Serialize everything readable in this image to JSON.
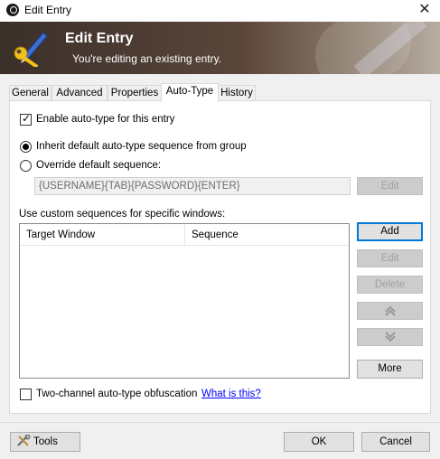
{
  "window": {
    "title": "Edit Entry",
    "close_glyph": "✕"
  },
  "banner": {
    "heading": "Edit Entry",
    "subheading": "You're editing an existing entry."
  },
  "tabs": [
    {
      "label": "General"
    },
    {
      "label": "Advanced"
    },
    {
      "label": "Properties"
    },
    {
      "label": "Auto-Type"
    },
    {
      "label": "History"
    }
  ],
  "active_tab": "Auto-Type",
  "autotype": {
    "enable_label": "Enable auto-type for this entry",
    "enable_checked": true,
    "inherit_label": "Inherit default auto-type sequence from group",
    "override_label": "Override default sequence:",
    "selected_option": "inherit",
    "sequence_value": "{USERNAME}{TAB}{PASSWORD}{ENTER}",
    "sequence_edit_label": "Edit",
    "custom_label": "Use custom sequences for specific windows:",
    "columns": [
      "Target Window",
      "Sequence"
    ],
    "rows": [],
    "buttons": {
      "add": "Add",
      "edit": "Edit",
      "delete": "Delete",
      "up_icon": "double-chevron-up-icon",
      "down_icon": "double-chevron-down-icon",
      "more": "More"
    },
    "obfuscation_label": "Two-channel auto-type obfuscation",
    "obfuscation_checked": false,
    "what_is_this": "What is this?"
  },
  "footer": {
    "tools": "Tools",
    "ok": "OK",
    "cancel": "Cancel"
  }
}
